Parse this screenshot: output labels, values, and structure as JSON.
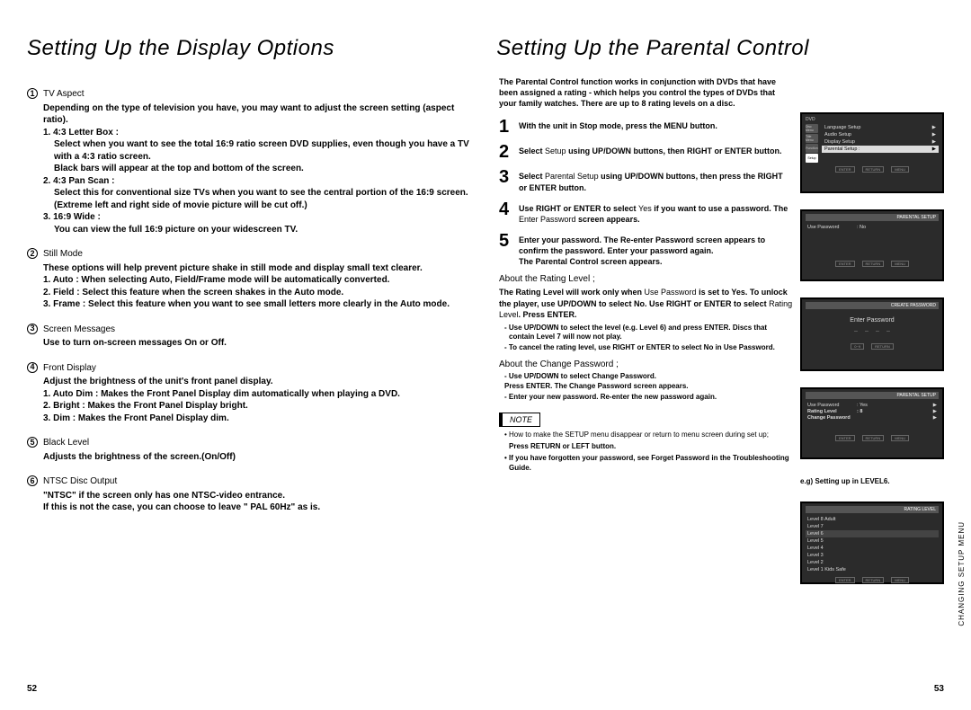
{
  "left": {
    "title": "Setting Up the Display Options",
    "sections": [
      {
        "num": "1",
        "head": "TV Aspect",
        "body": "Depending on the type of television you have, you may want to adjust the screen setting (aspect ratio).",
        "items": [
          {
            "no": "1.",
            "title": "4:3 Letter Box :",
            "text": "Select when you want to see the total 16:9 ratio screen DVD supplies, even though you have a TV with a 4:3 ratio screen.",
            "text2": "Black bars will appear at the top and bottom of the screen."
          },
          {
            "no": "2.",
            "title": "4:3 Pan Scan :",
            "text": "Select this for conventional size TVs when you want to see the central portion of the 16:9 screen. (Extreme left and right side of movie picture will be cut off.)"
          },
          {
            "no": "3.",
            "title": "16:9 Wide :",
            "text": "You can view the full 16:9 picture on your widescreen TV."
          }
        ]
      },
      {
        "num": "2",
        "head": "Still Mode",
        "body": "These options will help prevent picture shake in still mode and display small text clearer.",
        "items": [
          {
            "no": "1.",
            "text": "Auto : When selecting Auto, Field/Frame mode will be automatically converted."
          },
          {
            "no": "2.",
            "text": "Field : Select this feature when the screen shakes in the Auto mode."
          },
          {
            "no": "3.",
            "text": "Frame : Select this feature when you want to see small letters more clearly in the Auto mode."
          }
        ]
      },
      {
        "num": "3",
        "head": "Screen Messages",
        "body": "Use to turn on-screen messages On or Off."
      },
      {
        "num": "4",
        "head": "Front Display",
        "body": "Adjust the brightness of the unit's front panel display.",
        "items": [
          {
            "no": "1.",
            "text": "Auto Dim : Makes the Front Panel Display dim automatically when playing a DVD."
          },
          {
            "no": "2.",
            "text": "Bright : Makes the Front Panel Display bright."
          },
          {
            "no": "3.",
            "text": "Dim : Makes the Front Panel Display dim."
          }
        ]
      },
      {
        "num": "5",
        "head": "Black Level",
        "body": "Adjusts the brightness of the screen.(On/Off)"
      },
      {
        "num": "6",
        "head": "NTSC Disc Output",
        "body": "\"NTSC\" if the screen only has one NTSC-video entrance.",
        "body2": "If this is not the case, you can choose to leave \" PAL 60Hz\" as is."
      }
    ],
    "pagenum": "52"
  },
  "right": {
    "title": "Setting Up the Parental Control",
    "intro": "The Parental Control function works in conjunction with DVDs that have been assigned a rating - which helps you control the types of DVDs that your family watches. There are up to 8 rating levels on a disc.",
    "steps": [
      {
        "n": "1",
        "text_parts": [
          "With the unit in Stop mode, press the MENU button."
        ]
      },
      {
        "n": "2",
        "text_parts": [
          "Select ",
          "Setup",
          " using UP/DOWN buttons, then RIGHT or ENTER button."
        ]
      },
      {
        "n": "3",
        "text_parts": [
          "Select ",
          "Parental Setup",
          " using UP/DOWN buttons, then press the RIGHT or ENTER button."
        ]
      },
      {
        "n": "4",
        "text_parts": [
          "Use RIGHT or ENTER to select ",
          "Yes",
          " if you want to use a password. The ",
          "Enter Password",
          " screen appears."
        ]
      },
      {
        "n": "5",
        "text_parts": [
          "Enter your password. The Re-enter Password screen appears to confirm the password. Enter your password again.",
          " The Parental Control screen appears."
        ]
      }
    ],
    "about_rating": {
      "head": "About the Rating Level   ;",
      "body_parts": [
        "The Rating Level will work only when ",
        "Use Password",
        " is set to Yes. To unlock the player, use UP/DOWN to select No. Use RIGHT or ENTER to select ",
        "Rating Level",
        ". Press ENTER."
      ],
      "notes": [
        "- Use UP/DOWN to select the level (e.g. Level 6) and press ENTER. Discs that contain Level 7 will now not play.",
        "- To cancel the rating level, use RIGHT or ENTER to select No in Use Password."
      ]
    },
    "about_change": {
      "head": "About the Change Password   ;",
      "notes": [
        "- Use UP/DOWN to select Change Password.",
        "  Press ENTER. The Change Password screen appears.",
        "- Enter your new password. Re-enter the new password again."
      ]
    },
    "notebox": "NOTE",
    "notelist": [
      "• How to make the SETUP menu disappear or return to menu screen during set up;",
      "Press RETURN or LEFT button.",
      "• If you have forgotten your password, see Forget Password in the Troubleshooting Guide."
    ],
    "caption_eg": "e.g) Setting up in LEVEL6.",
    "pagenum": "53",
    "sidelabel": "CHANGING\nSETUP MENU",
    "osd": {
      "dvd_label": "DVD",
      "menu": {
        "items": [
          {
            "label": "Language Setup",
            "arr": "▶"
          },
          {
            "label": "Audio Setup",
            "arr": "▶"
          },
          {
            "label": "Display Setup",
            "arr": "▶"
          },
          {
            "label": "Parental Setup :",
            "arr": "▶",
            "hl": true
          }
        ],
        "icons": [
          "Disc Menu",
          "Title Menu",
          "Function",
          "Setup"
        ],
        "bottom": [
          "ENTER",
          "RETURN",
          "MENU"
        ]
      },
      "parental_no": {
        "titlebar": "PARENTAL SETUP",
        "rows": [
          {
            "lab": "Use Password",
            "val": ": No"
          }
        ]
      },
      "create_pw": {
        "titlebar": "CREATE PASSWORD",
        "label": "Enter Password",
        "dots": [
          "–",
          "–",
          "–",
          "–"
        ]
      },
      "parental_yes": {
        "titlebar": "PARENTAL SETUP",
        "rows": [
          {
            "lab": "Use Password",
            "val": ": Yes",
            "arr": "▶"
          },
          {
            "lab": "Rating Level",
            "val": ": 8",
            "arr": "▶"
          },
          {
            "lab": "Change Password",
            "val": "",
            "arr": "▶"
          }
        ]
      },
      "rating_level": {
        "titlebar": "RATING LEVEL",
        "items": [
          "Level 8 Adult",
          "Level 7",
          "Level 6",
          "Level 5",
          "Level 4",
          "Level 3",
          "Level 2",
          "Level 1 Kids Safe"
        ],
        "hl_index": 2
      }
    }
  }
}
